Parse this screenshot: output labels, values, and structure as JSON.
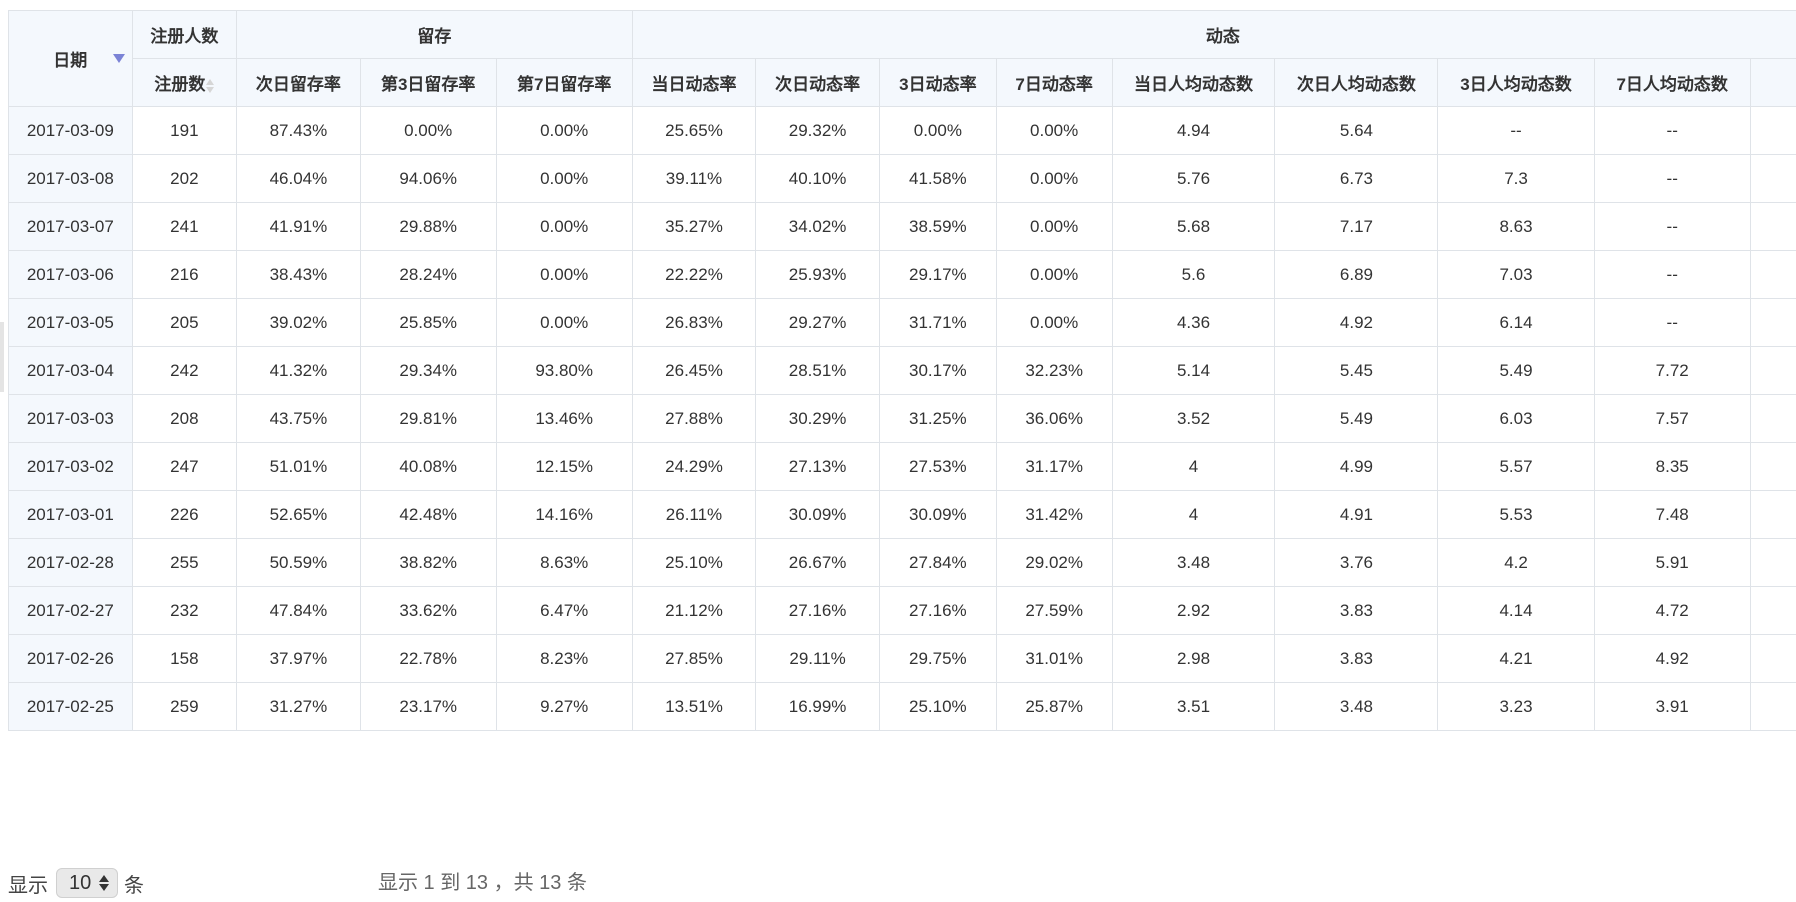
{
  "colors": {
    "header_bg": "#f4f8fd",
    "border": "#dfe3e8",
    "sort_active": "#7b83d6"
  },
  "header": {
    "date": "日期",
    "group_register": "注册人数",
    "group_retention": "留存",
    "group_activity": "动态",
    "register_count": "注册数",
    "retention_day2": "次日留存率",
    "retention_day3": "第3日留存率",
    "retention_day7": "第7日留存率",
    "activity_rate_day0": "当日动态率",
    "activity_rate_day1": "次日动态率",
    "activity_rate_day3": "3日动态率",
    "activity_rate_day7": "7日动态率",
    "avg_activity_day0": "当日人均动态数",
    "avg_activity_day1": "次日人均动态数",
    "avg_activity_day3": "3日人均动态数",
    "avg_activity_day7": "7日人均动态数"
  },
  "rows": [
    [
      "2017-03-09",
      "191",
      "87.43%",
      "0.00%",
      "0.00%",
      "25.65%",
      "29.32%",
      "0.00%",
      "0.00%",
      "4.94",
      "5.64",
      "--",
      "--"
    ],
    [
      "2017-03-08",
      "202",
      "46.04%",
      "94.06%",
      "0.00%",
      "39.11%",
      "40.10%",
      "41.58%",
      "0.00%",
      "5.76",
      "6.73",
      "7.3",
      "--"
    ],
    [
      "2017-03-07",
      "241",
      "41.91%",
      "29.88%",
      "0.00%",
      "35.27%",
      "34.02%",
      "38.59%",
      "0.00%",
      "5.68",
      "7.17",
      "8.63",
      "--"
    ],
    [
      "2017-03-06",
      "216",
      "38.43%",
      "28.24%",
      "0.00%",
      "22.22%",
      "25.93%",
      "29.17%",
      "0.00%",
      "5.6",
      "6.89",
      "7.03",
      "--"
    ],
    [
      "2017-03-05",
      "205",
      "39.02%",
      "25.85%",
      "0.00%",
      "26.83%",
      "29.27%",
      "31.71%",
      "0.00%",
      "4.36",
      "4.92",
      "6.14",
      "--"
    ],
    [
      "2017-03-04",
      "242",
      "41.32%",
      "29.34%",
      "93.80%",
      "26.45%",
      "28.51%",
      "30.17%",
      "32.23%",
      "5.14",
      "5.45",
      "5.49",
      "7.72"
    ],
    [
      "2017-03-03",
      "208",
      "43.75%",
      "29.81%",
      "13.46%",
      "27.88%",
      "30.29%",
      "31.25%",
      "36.06%",
      "3.52",
      "5.49",
      "6.03",
      "7.57"
    ],
    [
      "2017-03-02",
      "247",
      "51.01%",
      "40.08%",
      "12.15%",
      "24.29%",
      "27.13%",
      "27.53%",
      "31.17%",
      "4",
      "4.99",
      "5.57",
      "8.35"
    ],
    [
      "2017-03-01",
      "226",
      "52.65%",
      "42.48%",
      "14.16%",
      "26.11%",
      "30.09%",
      "30.09%",
      "31.42%",
      "4",
      "4.91",
      "5.53",
      "7.48"
    ],
    [
      "2017-02-28",
      "255",
      "50.59%",
      "38.82%",
      "8.63%",
      "25.10%",
      "26.67%",
      "27.84%",
      "29.02%",
      "3.48",
      "3.76",
      "4.2",
      "5.91"
    ],
    [
      "2017-02-27",
      "232",
      "47.84%",
      "33.62%",
      "6.47%",
      "21.12%",
      "27.16%",
      "27.16%",
      "27.59%",
      "2.92",
      "3.83",
      "4.14",
      "4.72"
    ],
    [
      "2017-02-26",
      "158",
      "37.97%",
      "22.78%",
      "8.23%",
      "27.85%",
      "29.11%",
      "29.75%",
      "31.01%",
      "2.98",
      "3.83",
      "4.21",
      "4.92"
    ],
    [
      "2017-02-25",
      "259",
      "31.27%",
      "23.17%",
      "9.27%",
      "13.51%",
      "16.99%",
      "25.10%",
      "25.87%",
      "3.51",
      "3.48",
      "3.23",
      "3.91"
    ]
  ],
  "footer": {
    "show_prefix": "显示",
    "page_size": "10",
    "show_suffix": "条",
    "info": "显示 1 到 13 ，共 13 条"
  },
  "icons": {
    "date_sort": "sort-desc-icon",
    "register_sort": "sort-both-icon",
    "page_size_arrows": "updown-icon"
  }
}
